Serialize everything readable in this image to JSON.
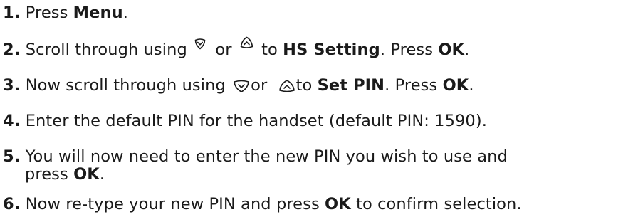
{
  "steps": [
    {
      "num": "1",
      "parts": [
        "Press ",
        "Menu",
        "."
      ]
    },
    {
      "num": "2",
      "parts": [
        "Scroll through using ",
        " or ",
        " to ",
        "HS Setting",
        ". Press ",
        "OK",
        "."
      ]
    },
    {
      "num": "3",
      "parts": [
        "Now scroll through using ",
        "or ",
        "to ",
        "Set PIN",
        ". Press ",
        "OK",
        "."
      ]
    },
    {
      "num": "4",
      "parts": [
        "Enter the default PIN for the handset (default PIN: 1590)."
      ]
    },
    {
      "num": "5",
      "parts": [
        "You will now need to enter the new PIN you wish to use and",
        "press ",
        "OK",
        "."
      ]
    },
    {
      "num": "6",
      "parts": [
        "Now re-type your new PIN and press ",
        "OK",
        " to confirm selection."
      ]
    }
  ],
  "icons": {
    "scroll_down": "scroll-down-key-icon",
    "scroll_up": "scroll-up-key-icon"
  }
}
